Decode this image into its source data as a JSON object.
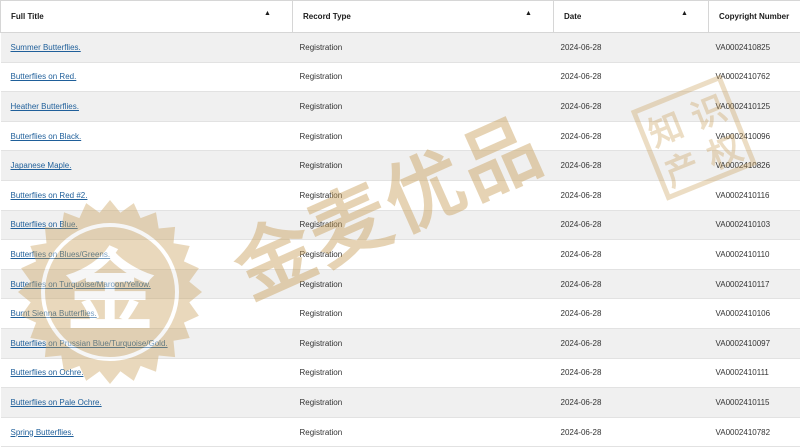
{
  "columns": [
    {
      "label": "Full Title",
      "sortable": true
    },
    {
      "label": "Record Type",
      "sortable": true
    },
    {
      "label": "Date",
      "sortable": true
    },
    {
      "label": "Copyright Number",
      "sortable": false
    }
  ],
  "sort_glyph": "▲",
  "rows": [
    {
      "title": "Summer Butterflies.",
      "type": "Registration",
      "date": "2024-06-28",
      "number": "VA0002410825"
    },
    {
      "title": "Butterflies on Red.",
      "type": "Registration",
      "date": "2024-06-28",
      "number": "VA0002410762"
    },
    {
      "title": "Heather Butterflies.",
      "type": "Registration",
      "date": "2024-06-28",
      "number": "VA0002410125"
    },
    {
      "title": "Butterflies on Black.",
      "type": "Registration",
      "date": "2024-06-28",
      "number": "VA0002410096"
    },
    {
      "title": "Japanese Maple.",
      "type": "Registration",
      "date": "2024-06-28",
      "number": "VA0002410826"
    },
    {
      "title": "Butterflies on Red #2.",
      "type": "Registration",
      "date": "2024-06-28",
      "number": "VA0002410116"
    },
    {
      "title": "Butterflies on Blue.",
      "type": "Registration",
      "date": "2024-06-28",
      "number": "VA0002410103"
    },
    {
      "title": "Butterflies on Blues/Greens.",
      "type": "Registration",
      "date": "2024-06-28",
      "number": "VA0002410110"
    },
    {
      "title": "Butterflies on Turquoise/Maroon/Yellow.",
      "type": "Registration",
      "date": "2024-06-28",
      "number": "VA0002410117"
    },
    {
      "title": "Burnt Sienna Butterflies.",
      "type": "Registration",
      "date": "2024-06-28",
      "number": "VA0002410106"
    },
    {
      "title": "Butterflies on Prussian Blue/Turquoise/Gold.",
      "type": "Registration",
      "date": "2024-06-28",
      "number": "VA0002410097"
    },
    {
      "title": "Butterflies on Ochre.",
      "type": "Registration",
      "date": "2024-06-28",
      "number": "VA0002410111"
    },
    {
      "title": "Butterflies on Pale Ochre.",
      "type": "Registration",
      "date": "2024-06-28",
      "number": "VA0002410115"
    },
    {
      "title": "Spring Butterflies.",
      "type": "Registration",
      "date": "2024-06-28",
      "number": "VA0002410782"
    }
  ],
  "watermark": {
    "text": "金麦优品",
    "badge_char": "金",
    "seal_chars": [
      "知",
      "识",
      "产",
      "权"
    ],
    "color": "#c9a05a"
  }
}
